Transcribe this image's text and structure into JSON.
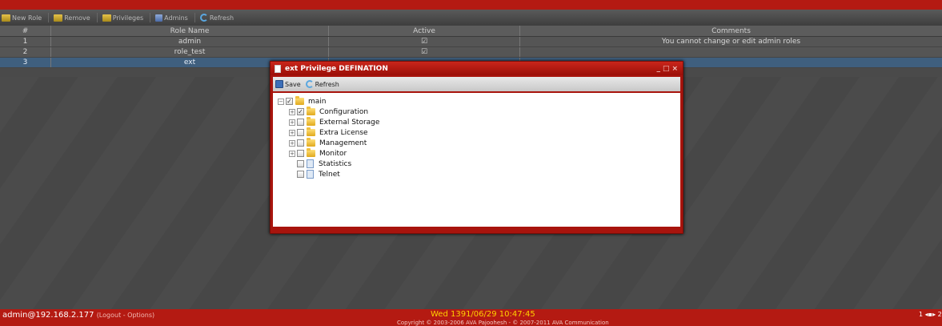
{
  "toolbar": {
    "new_role": "New Role",
    "remove": "Remove",
    "privileges": "Privileges",
    "admins": "Admins",
    "refresh": "Refresh"
  },
  "grid": {
    "headers": [
      "#",
      "Role Name",
      "Active",
      "Comments"
    ],
    "rows": [
      {
        "num": "1",
        "name": "admin",
        "active": "☑",
        "comment": "You cannot change or edit admin roles"
      },
      {
        "num": "2",
        "name": "role_test",
        "active": "☑",
        "comment": ""
      },
      {
        "num": "3",
        "name": "ext",
        "active": "",
        "comment": ""
      }
    ]
  },
  "dialog": {
    "title": "ext Privilege DEFINATION",
    "save_label": "Save",
    "refresh_label": "Refresh",
    "tree": {
      "root": "main",
      "children": [
        "Configuration",
        "External Storage",
        "Extra License",
        "Management",
        "Monitor",
        "Statistics",
        "Telnet"
      ]
    }
  },
  "status": {
    "user": "admin@192.168.2.177",
    "links": "(Logout - Options)",
    "datetime": "Wed  1391/06/29  10:47:45",
    "copyright": "Copyright © 2003-2006 AVA Pajoohesh  -  © 2007-2011 AVA Communication",
    "pager": "1 ◂▪▸ 2 ‹"
  },
  "colors": {
    "accent_red": "#b41a12",
    "selected_row": "#3f5f7e",
    "date_yellow": "#ffd000"
  }
}
